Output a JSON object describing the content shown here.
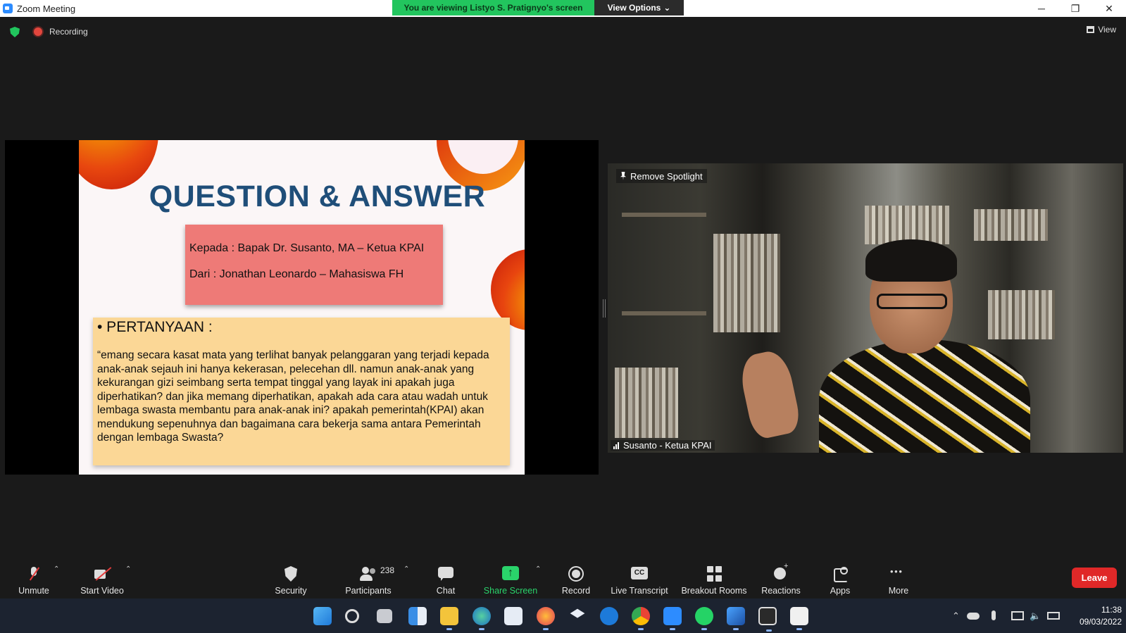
{
  "window": {
    "title": "Zoom Meeting",
    "minimize": "─",
    "restore": "❐",
    "close": "✕"
  },
  "share_banner": {
    "message": "You are viewing Listyo S. Pratignyo's screen",
    "view_options": "View Options",
    "caret": "⌄"
  },
  "status": {
    "recording_label": "Recording",
    "view_label": "View"
  },
  "slide": {
    "title": "QUESTION & ANSWER",
    "to_line": "Kepada : Bapak Dr. Susanto, MA – Ketua KPAI",
    "from_line": "Dari : Jonathan Leonardo – Mahasiswa FH",
    "question_heading": "• PERTANYAAN :",
    "question_text": "“emang secara kasat mata yang terlihat banyak pelanggaran yang terjadi kepada anak-anak sejauh ini hanya kekerasan, pelecehan dll. namun anak-anak yang kekurangan gizi seimbang serta tempat tinggal yang layak ini apakah juga diperhatikan? dan jika memang diperhatikan, apakah ada cara atau wadah untuk lembaga swasta membantu para anak-anak ini? apakah pemerintah(KPAI) akan mendukung sepenuhnya dan bagaimana cara bekerja sama antara Pemerintah dengan lembaga Swasta?"
  },
  "video": {
    "spotlight_label": "Remove Spotlight",
    "participant_name": "Susanto - Ketua KPAI"
  },
  "toolbar": {
    "unmute": "Unmute",
    "start_video": "Start Video",
    "security": "Security",
    "participants": "Participants",
    "participant_count": "238",
    "chat": "Chat",
    "share_screen": "Share Screen",
    "record": "Record",
    "live_transcript": "Live Transcript",
    "breakout_rooms": "Breakout Rooms",
    "reactions": "Reactions",
    "apps": "Apps",
    "more": "More",
    "leave": "Leave",
    "caret_up": "⌃"
  },
  "taskbar": {
    "apps": [
      "start-icon",
      "search-icon",
      "task-view-icon",
      "widgets-icon",
      "file-explorer-icon",
      "edge-icon",
      "store-icon",
      "firefox-icon",
      "dropbox-icon",
      "app-icon",
      "chrome-icon",
      "zoom-icon",
      "whatsapp-icon",
      "photos-icon",
      "notion-icon",
      "snipping-icon"
    ],
    "time": "11:38",
    "date": "09/03/2022"
  },
  "colors": {
    "share_banner": "#22c55e",
    "slide_title": "#1f4e79",
    "addr_box": "#ee7a77",
    "question_box": "#fbd796",
    "leave_button": "#e02828",
    "share_screen_icon": "#2ad36b"
  }
}
